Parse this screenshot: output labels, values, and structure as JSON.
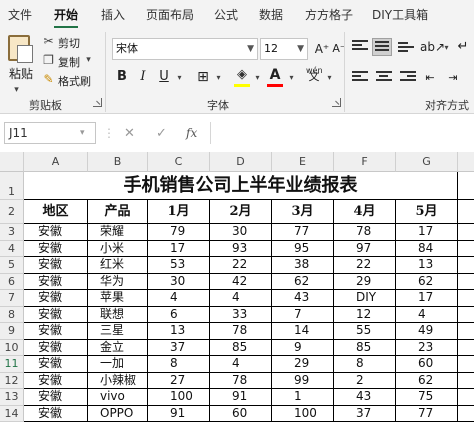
{
  "menu": {
    "tabs": [
      "文件",
      "开始",
      "插入",
      "页面布局",
      "公式",
      "数据",
      "方方格子",
      "DIY工具箱"
    ],
    "active": "开始"
  },
  "ribbon": {
    "clipboard": {
      "paste_label": "粘贴",
      "cut_label": "剪切",
      "copy_label": "复制",
      "format_painter_label": "格式刷",
      "group_label": "剪贴板"
    },
    "font": {
      "font_name": "宋体",
      "font_size": "12",
      "grow_icon": "A⁺",
      "shrink_icon": "A⁻",
      "bold": "B",
      "italic": "I",
      "underline": "U",
      "wen_label": "wén",
      "group_label": "字体"
    },
    "alignment": {
      "group_label": "对齐方式"
    }
  },
  "formula_bar": {
    "name_box": "J11",
    "fx": "fx"
  },
  "columns": [
    "A",
    "B",
    "C",
    "D",
    "E",
    "F",
    "G"
  ],
  "rows": [
    "1",
    "2",
    "3",
    "4",
    "5",
    "6",
    "7",
    "8",
    "9",
    "10",
    "11",
    "12",
    "13",
    "14"
  ],
  "selected_row": "11",
  "table": {
    "title": "手机销售公司上半年业绩报表",
    "headers": [
      "地区",
      "产品",
      "1月",
      "2月",
      "3月",
      "4月",
      "5月"
    ],
    "rows": [
      [
        "安徽",
        "荣耀",
        "79",
        "30",
        "77",
        "78",
        "17"
      ],
      [
        "安徽",
        "小米",
        "17",
        "93",
        "95",
        "97",
        "84"
      ],
      [
        "安徽",
        "红米",
        "53",
        "22",
        "38",
        "22",
        "13"
      ],
      [
        "安徽",
        "华为",
        "30",
        "42",
        "62",
        "29",
        "62"
      ],
      [
        "安徽",
        "苹果",
        "4",
        "4",
        "43",
        "DIY",
        "17"
      ],
      [
        "安徽",
        "联想",
        "6",
        "33",
        "7",
        "12",
        "4"
      ],
      [
        "安徽",
        "三星",
        "13",
        "78",
        "14",
        "55",
        "49"
      ],
      [
        "安徽",
        "金立",
        "37",
        "85",
        "9",
        "85",
        "23"
      ],
      [
        "安徽",
        "一加",
        "8",
        "4",
        "29",
        "8",
        "60"
      ],
      [
        "安徽",
        "小辣椒",
        "27",
        "78",
        "99",
        "2",
        "62"
      ],
      [
        "安徽",
        "vivo",
        "100",
        "91",
        "1",
        "43",
        "75"
      ],
      [
        "安徽",
        "OPPO",
        "91",
        "60",
        "100",
        "37",
        "77"
      ]
    ]
  }
}
